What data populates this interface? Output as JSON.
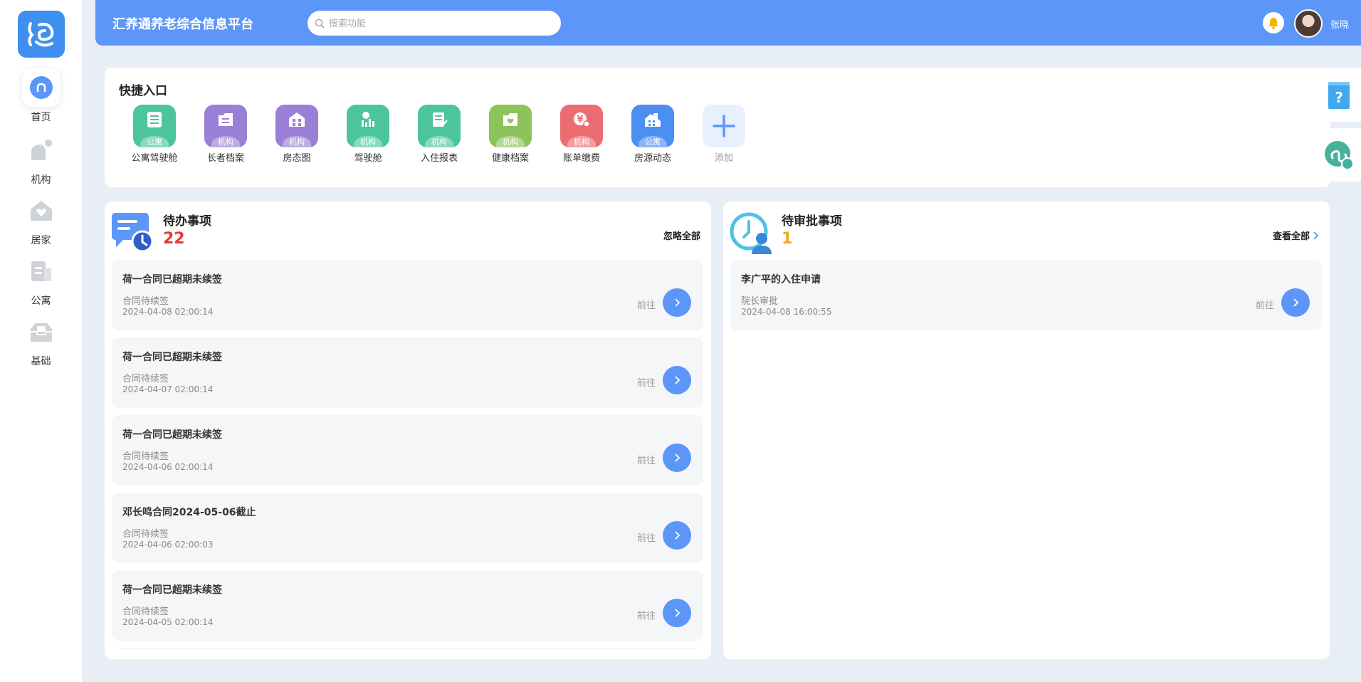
{
  "header": {
    "title": "汇养通养老综合信息平台",
    "search_placeholder": "搜索功能",
    "username": "张晓"
  },
  "sidebar": {
    "items": [
      {
        "label": "首页",
        "icon": "home-icon",
        "active": true
      },
      {
        "label": "机构",
        "icon": "institution-icon"
      },
      {
        "label": "居家",
        "icon": "house-heart-icon"
      },
      {
        "label": "公寓",
        "icon": "apartment-icon"
      },
      {
        "label": "基础",
        "icon": "basics-icon"
      }
    ]
  },
  "quick_access": {
    "title": "快捷入口",
    "items": [
      {
        "label": "公寓驾驶舱",
        "tag": "公寓",
        "color": "#4cc59b",
        "icon": "cockpit-icon"
      },
      {
        "label": "长者档案",
        "tag": "机构",
        "color": "#9a7fd6",
        "icon": "archive-icon"
      },
      {
        "label": "房态图",
        "tag": "机构",
        "color": "#9a7fd6",
        "icon": "room-status-icon"
      },
      {
        "label": "驾驶舱",
        "tag": "机构",
        "color": "#4cc59b",
        "icon": "dashboard-icon"
      },
      {
        "label": "入住报表",
        "tag": "机构",
        "color": "#4cc59b",
        "icon": "report-icon"
      },
      {
        "label": "健康档案",
        "tag": "机构",
        "color": "#8cc35a",
        "icon": "health-record-icon"
      },
      {
        "label": "账单缴费",
        "tag": "机构",
        "color": "#ec6c72",
        "icon": "billing-icon"
      },
      {
        "label": "房源动态",
        "tag": "公寓",
        "color": "#4c8ef2",
        "icon": "housing-icon"
      }
    ],
    "add_label": "添加"
  },
  "todo": {
    "title": "待办事项",
    "count": "22",
    "action": "忽略全部",
    "go_label": "前往",
    "items": [
      {
        "title": "荷一合同已超期未续签",
        "subtitle": "合同待续签",
        "date": "2024-04-08 02:00:14"
      },
      {
        "title": "荷一合同已超期未续签",
        "subtitle": "合同待续签",
        "date": "2024-04-07 02:00:14"
      },
      {
        "title": "荷一合同已超期未续签",
        "subtitle": "合同待续签",
        "date": "2024-04-06 02:00:14"
      },
      {
        "title": "邓长鸣合同2024-05-06截止",
        "subtitle": "合同待续签",
        "date": "2024-04-06 02:00:03"
      },
      {
        "title": "荷一合同已超期未续签",
        "subtitle": "合同待续签",
        "date": "2024-04-05 02:00:14"
      }
    ]
  },
  "approval": {
    "title": "待审批事项",
    "count": "1",
    "action": "查看全部",
    "go_label": "前往",
    "items": [
      {
        "title": "李广平的入住申请",
        "subtitle": "院长审批",
        "date": "2024-04-08 16:00:55"
      }
    ]
  },
  "colors": {
    "primary": "#5b96f8",
    "todo_count": "#e53935",
    "approval_count": "#f5a623"
  }
}
